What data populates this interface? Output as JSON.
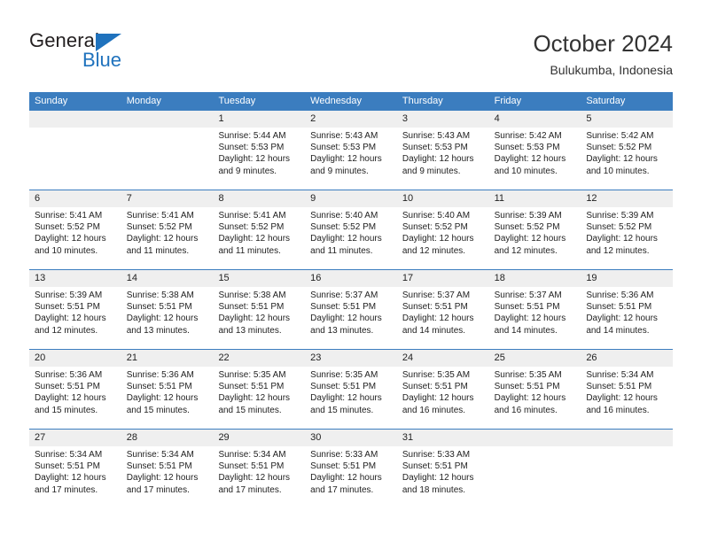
{
  "logo": {
    "word_one": "General",
    "word_two": "Blue",
    "triangle_color": "#1f72bd",
    "text_color": "#231f20"
  },
  "header": {
    "title": "October 2024",
    "location": "Bulukumba, Indonesia"
  },
  "calendar": {
    "accent_color": "#3b7dbf",
    "day_band_color": "#efefef",
    "weekdays": [
      "Sunday",
      "Monday",
      "Tuesday",
      "Wednesday",
      "Thursday",
      "Friday",
      "Saturday"
    ],
    "weeks": [
      [
        {
          "day": "",
          "sunrise": "",
          "sunset": "",
          "daylight": ""
        },
        {
          "day": "",
          "sunrise": "",
          "sunset": "",
          "daylight": ""
        },
        {
          "day": "1",
          "sunrise": "Sunrise: 5:44 AM",
          "sunset": "Sunset: 5:53 PM",
          "daylight": "Daylight: 12 hours and 9 minutes."
        },
        {
          "day": "2",
          "sunrise": "Sunrise: 5:43 AM",
          "sunset": "Sunset: 5:53 PM",
          "daylight": "Daylight: 12 hours and 9 minutes."
        },
        {
          "day": "3",
          "sunrise": "Sunrise: 5:43 AM",
          "sunset": "Sunset: 5:53 PM",
          "daylight": "Daylight: 12 hours and 9 minutes."
        },
        {
          "day": "4",
          "sunrise": "Sunrise: 5:42 AM",
          "sunset": "Sunset: 5:53 PM",
          "daylight": "Daylight: 12 hours and 10 minutes."
        },
        {
          "day": "5",
          "sunrise": "Sunrise: 5:42 AM",
          "sunset": "Sunset: 5:52 PM",
          "daylight": "Daylight: 12 hours and 10 minutes."
        }
      ],
      [
        {
          "day": "6",
          "sunrise": "Sunrise: 5:41 AM",
          "sunset": "Sunset: 5:52 PM",
          "daylight": "Daylight: 12 hours and 10 minutes."
        },
        {
          "day": "7",
          "sunrise": "Sunrise: 5:41 AM",
          "sunset": "Sunset: 5:52 PM",
          "daylight": "Daylight: 12 hours and 11 minutes."
        },
        {
          "day": "8",
          "sunrise": "Sunrise: 5:41 AM",
          "sunset": "Sunset: 5:52 PM",
          "daylight": "Daylight: 12 hours and 11 minutes."
        },
        {
          "day": "9",
          "sunrise": "Sunrise: 5:40 AM",
          "sunset": "Sunset: 5:52 PM",
          "daylight": "Daylight: 12 hours and 11 minutes."
        },
        {
          "day": "10",
          "sunrise": "Sunrise: 5:40 AM",
          "sunset": "Sunset: 5:52 PM",
          "daylight": "Daylight: 12 hours and 12 minutes."
        },
        {
          "day": "11",
          "sunrise": "Sunrise: 5:39 AM",
          "sunset": "Sunset: 5:52 PM",
          "daylight": "Daylight: 12 hours and 12 minutes."
        },
        {
          "day": "12",
          "sunrise": "Sunrise: 5:39 AM",
          "sunset": "Sunset: 5:52 PM",
          "daylight": "Daylight: 12 hours and 12 minutes."
        }
      ],
      [
        {
          "day": "13",
          "sunrise": "Sunrise: 5:39 AM",
          "sunset": "Sunset: 5:51 PM",
          "daylight": "Daylight: 12 hours and 12 minutes."
        },
        {
          "day": "14",
          "sunrise": "Sunrise: 5:38 AM",
          "sunset": "Sunset: 5:51 PM",
          "daylight": "Daylight: 12 hours and 13 minutes."
        },
        {
          "day": "15",
          "sunrise": "Sunrise: 5:38 AM",
          "sunset": "Sunset: 5:51 PM",
          "daylight": "Daylight: 12 hours and 13 minutes."
        },
        {
          "day": "16",
          "sunrise": "Sunrise: 5:37 AM",
          "sunset": "Sunset: 5:51 PM",
          "daylight": "Daylight: 12 hours and 13 minutes."
        },
        {
          "day": "17",
          "sunrise": "Sunrise: 5:37 AM",
          "sunset": "Sunset: 5:51 PM",
          "daylight": "Daylight: 12 hours and 14 minutes."
        },
        {
          "day": "18",
          "sunrise": "Sunrise: 5:37 AM",
          "sunset": "Sunset: 5:51 PM",
          "daylight": "Daylight: 12 hours and 14 minutes."
        },
        {
          "day": "19",
          "sunrise": "Sunrise: 5:36 AM",
          "sunset": "Sunset: 5:51 PM",
          "daylight": "Daylight: 12 hours and 14 minutes."
        }
      ],
      [
        {
          "day": "20",
          "sunrise": "Sunrise: 5:36 AM",
          "sunset": "Sunset: 5:51 PM",
          "daylight": "Daylight: 12 hours and 15 minutes."
        },
        {
          "day": "21",
          "sunrise": "Sunrise: 5:36 AM",
          "sunset": "Sunset: 5:51 PM",
          "daylight": "Daylight: 12 hours and 15 minutes."
        },
        {
          "day": "22",
          "sunrise": "Sunrise: 5:35 AM",
          "sunset": "Sunset: 5:51 PM",
          "daylight": "Daylight: 12 hours and 15 minutes."
        },
        {
          "day": "23",
          "sunrise": "Sunrise: 5:35 AM",
          "sunset": "Sunset: 5:51 PM",
          "daylight": "Daylight: 12 hours and 15 minutes."
        },
        {
          "day": "24",
          "sunrise": "Sunrise: 5:35 AM",
          "sunset": "Sunset: 5:51 PM",
          "daylight": "Daylight: 12 hours and 16 minutes."
        },
        {
          "day": "25",
          "sunrise": "Sunrise: 5:35 AM",
          "sunset": "Sunset: 5:51 PM",
          "daylight": "Daylight: 12 hours and 16 minutes."
        },
        {
          "day": "26",
          "sunrise": "Sunrise: 5:34 AM",
          "sunset": "Sunset: 5:51 PM",
          "daylight": "Daylight: 12 hours and 16 minutes."
        }
      ],
      [
        {
          "day": "27",
          "sunrise": "Sunrise: 5:34 AM",
          "sunset": "Sunset: 5:51 PM",
          "daylight": "Daylight: 12 hours and 17 minutes."
        },
        {
          "day": "28",
          "sunrise": "Sunrise: 5:34 AM",
          "sunset": "Sunset: 5:51 PM",
          "daylight": "Daylight: 12 hours and 17 minutes."
        },
        {
          "day": "29",
          "sunrise": "Sunrise: 5:34 AM",
          "sunset": "Sunset: 5:51 PM",
          "daylight": "Daylight: 12 hours and 17 minutes."
        },
        {
          "day": "30",
          "sunrise": "Sunrise: 5:33 AM",
          "sunset": "Sunset: 5:51 PM",
          "daylight": "Daylight: 12 hours and 17 minutes."
        },
        {
          "day": "31",
          "sunrise": "Sunrise: 5:33 AM",
          "sunset": "Sunset: 5:51 PM",
          "daylight": "Daylight: 12 hours and 18 minutes."
        },
        {
          "day": "",
          "sunrise": "",
          "sunset": "",
          "daylight": ""
        },
        {
          "day": "",
          "sunrise": "",
          "sunset": "",
          "daylight": ""
        }
      ]
    ]
  }
}
